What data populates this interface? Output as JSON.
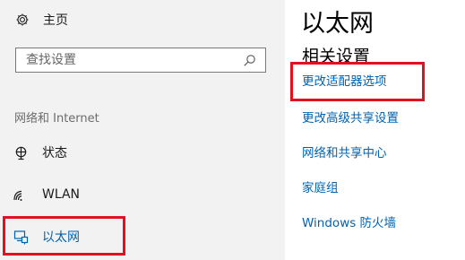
{
  "sidebar": {
    "home_label": "主页",
    "search": {
      "placeholder": "查找设置",
      "value": ""
    },
    "section_header": "网络和 Internet",
    "items": [
      {
        "label": "状态",
        "icon": "status-icon"
      },
      {
        "label": "WLAN",
        "icon": "wifi-icon"
      },
      {
        "label": "以太网",
        "icon": "ethernet-icon",
        "selected": true
      }
    ]
  },
  "main": {
    "title": "以太网",
    "related_settings_header": "相关设置",
    "links": [
      "更改适配器选项",
      "更改高级共享设置",
      "网络和共享中心",
      "家庭组",
      "Windows 防火墙"
    ]
  },
  "colors": {
    "accent": "#0063b1",
    "highlight_box": "#e3101d",
    "sidebar_bg": "#f2f2f2"
  }
}
